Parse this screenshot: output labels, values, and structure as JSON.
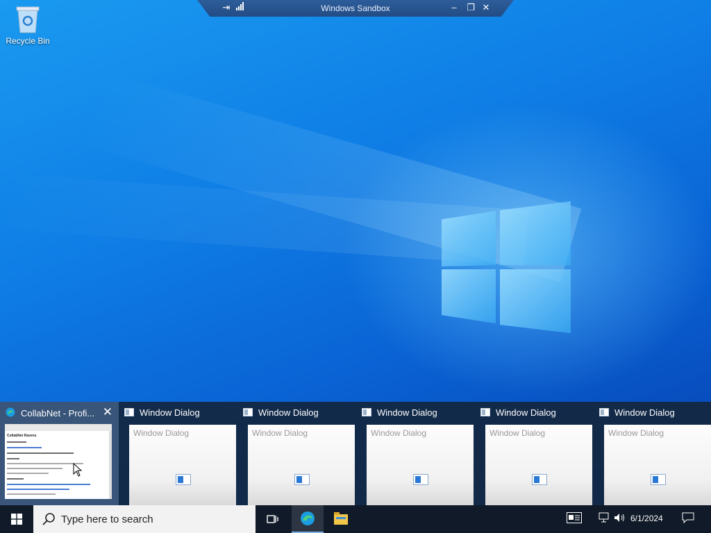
{
  "desktop": {
    "recycle_bin_label": "Recycle Bin"
  },
  "sandbox_bar": {
    "title": "Windows Sandbox",
    "icons": [
      "pin-icon",
      "signal-icon",
      "minimize-icon",
      "restore-icon",
      "close-icon"
    ]
  },
  "thumbnails": [
    {
      "title": "CollabNet - Profi...",
      "preview_title": "",
      "active": true,
      "icon": "edge-icon"
    },
    {
      "title": "Window Dialog",
      "preview_title": "Window Dialog",
      "active": false,
      "icon": "dialog-icon"
    },
    {
      "title": "Window Dialog",
      "preview_title": "Window Dialog",
      "active": false,
      "icon": "dialog-icon"
    },
    {
      "title": "Window Dialog",
      "preview_title": "Window Dialog",
      "active": false,
      "icon": "dialog-icon"
    },
    {
      "title": "Window Dialog",
      "preview_title": "Window Dialog",
      "active": false,
      "icon": "dialog-icon"
    },
    {
      "title": "Window Dialog",
      "preview_title": "Window Dialog",
      "active": false,
      "icon": "dialog-icon"
    }
  ],
  "browser_preview_heading": "CollabNet Ravens",
  "taskbar": {
    "search_placeholder": "Type here to search",
    "clock_date": "6/1/2024"
  },
  "colors": {
    "taskbar": "#101a28",
    "accent": "#1a9af0",
    "thumb_strip": "#14263e"
  }
}
